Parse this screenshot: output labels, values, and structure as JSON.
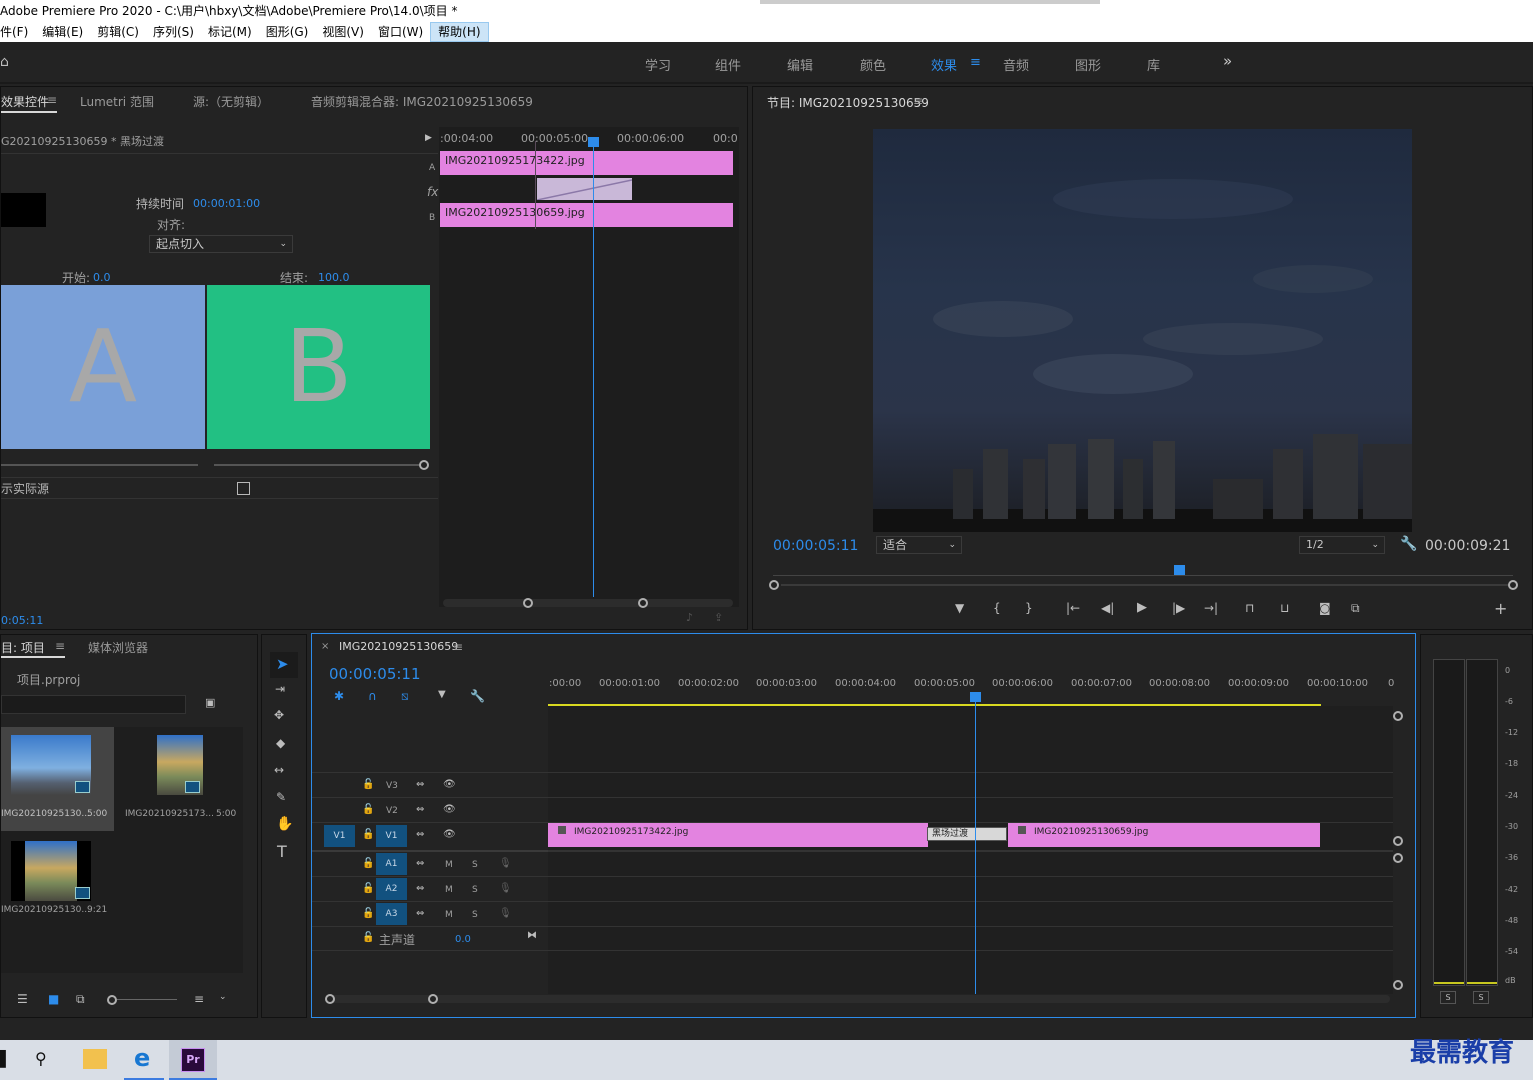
{
  "window": {
    "title": "Adobe Premiere Pro 2020 - C:\\用户\\hbxy\\文档\\Adobe\\Premiere Pro\\14.0\\项目 *"
  },
  "menu": [
    "件(F)",
    "编辑(E)",
    "剪辑(C)",
    "序列(S)",
    "标记(M)",
    "图形(G)",
    "视图(V)",
    "窗口(W)",
    "帮助(H)"
  ],
  "workspaces": {
    "tabs": [
      "学习",
      "组件",
      "编辑",
      "颜色",
      "效果",
      "音频",
      "图形",
      "库"
    ],
    "active": "效果",
    "more": "»"
  },
  "effect_controls": {
    "tabs": [
      "效果控件",
      "Lumetri 范围",
      "源:（无剪辑）",
      "音频剪辑混合器: IMG20210925130659"
    ],
    "clip_path": "G20210925130659 * 黑场过渡",
    "duration_label": "持续时间",
    "duration_value": "00:00:01:00",
    "align_label": "对齐:",
    "align_value": "起点切入",
    "start_label": "开始:",
    "start_value": "0.0",
    "end_label": "结束:",
    "end_value": "100.0",
    "a_letter": "A",
    "b_letter": "B",
    "show_actual_label": "示实际源",
    "timecode": "0:05:11",
    "mini_timeline": {
      "ruler": [
        ":00:04:00",
        "00:00:05:00",
        "00:00:06:00",
        "00:0"
      ],
      "clip_a": "IMG20210925173422.jpg",
      "clip_b": "IMG20210925130659.jpg",
      "label_a": "A",
      "label_fx": "fx",
      "label_b": "B"
    }
  },
  "program_monitor": {
    "title": "节目: IMG20210925130659",
    "current_time": "00:00:05:11",
    "fit": "适合",
    "resolution": "1/2",
    "duration": "00:00:09:21"
  },
  "project": {
    "tabs": [
      "目: 项目",
      "媒体浏览器"
    ],
    "file": "项目.prproj",
    "search_placeholder": "",
    "items": [
      {
        "name": "IMG20210925130...",
        "duration": "5:00"
      },
      {
        "name": "IMG20210925173...",
        "duration": "5:00"
      },
      {
        "name": "IMG20210925130...",
        "duration": "9:21"
      }
    ]
  },
  "timeline": {
    "tab": "IMG20210925130659",
    "timecode": "00:00:05:11",
    "ruler": [
      ":00:00",
      "00:00:01:00",
      "00:00:02:00",
      "00:00:03:00",
      "00:00:04:00",
      "00:00:05:00",
      "00:00:06:00",
      "00:00:07:00",
      "00:00:08:00",
      "00:00:09:00",
      "00:00:10:00",
      "0"
    ],
    "tracks": {
      "v3": "V3",
      "v2": "V2",
      "v1_src": "V1",
      "v1": "V1",
      "a1": "A1",
      "a2": "A2",
      "a3": "A3",
      "m": "M",
      "s": "S"
    },
    "master_label": "主声道",
    "master_value": "0.0",
    "clip1": "IMG20210925173422.jpg",
    "transition": "黑场过渡",
    "clip2": "IMG20210925130659.jpg"
  },
  "audio_meter": {
    "scale": [
      "0",
      "-6",
      "-12",
      "-18",
      "-24",
      "-30",
      "-36",
      "-42",
      "-48",
      "-54",
      "dB"
    ],
    "solo": [
      "S",
      "S"
    ]
  },
  "watermark": "最需教育"
}
